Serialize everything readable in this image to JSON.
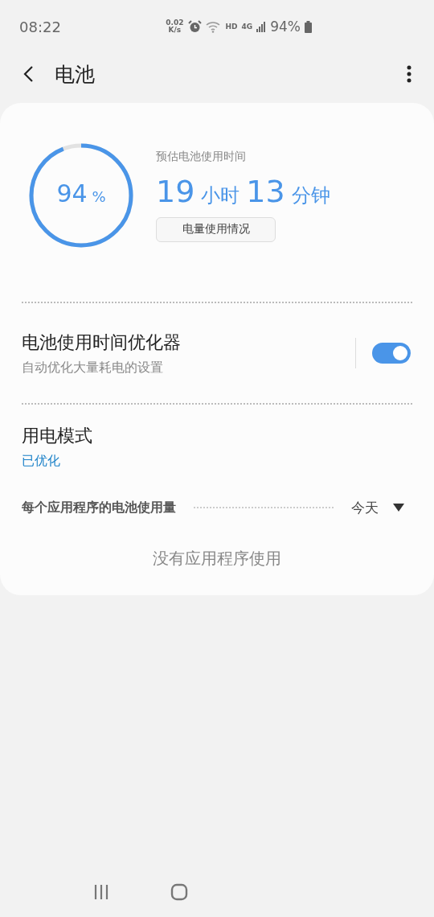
{
  "status_bar": {
    "time": "08:22",
    "net_speed": "0.02",
    "net_unit": "K/s",
    "hd": "HD",
    "network": "4G",
    "battery": "94%"
  },
  "header": {
    "title": "电池"
  },
  "battery": {
    "level": 0.94,
    "percent": "94",
    "percent_sign": "%",
    "estimate_label": "预估电池使用时间",
    "hours": "19",
    "hours_unit": "小时",
    "minutes": "13",
    "minutes_unit": "分钟",
    "usage_button": "电量使用情况"
  },
  "settings": [
    {
      "kind": "switch",
      "title": "电池使用时间优化器",
      "subtitle": "自动优化大量耗电的设置",
      "on": true
    },
    {
      "kind": "link",
      "title": "用电模式",
      "subtitle": "已优化"
    }
  ],
  "app_usage": {
    "label": "每个应用程序的电池使用量",
    "period": "今天",
    "empty": "没有应用程序使用"
  }
}
